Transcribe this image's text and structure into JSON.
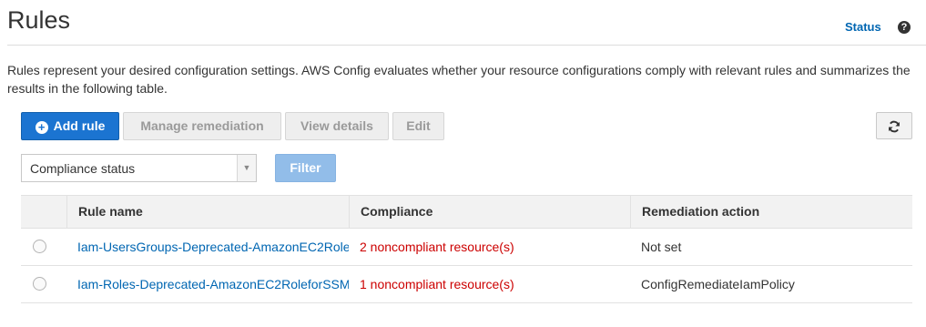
{
  "header": {
    "title": "Rules",
    "status_link": "Status",
    "help_symbol": "?"
  },
  "description": "Rules represent your desired configuration settings. AWS Config evaluates whether your resource configurations comply with relevant rules and summarizes the results in the following table.",
  "toolbar": {
    "add_rule": "Add rule",
    "add_rule_icon": "plus-circle-icon",
    "manage_remediation": "Manage remediation",
    "view_details": "View details",
    "edit": "Edit",
    "refresh_icon": "refresh-icon"
  },
  "filter": {
    "select_value": "Compliance status",
    "filter_button": "Filter"
  },
  "table": {
    "columns": [
      "Rule name",
      "Compliance",
      "Remediation action"
    ],
    "rows": [
      {
        "rule_name": "Iam-UsersGroups-Deprecated-AmazonEC2Role",
        "compliance": "2 noncompliant resource(s)",
        "remediation": "Not set"
      },
      {
        "rule_name": "Iam-Roles-Deprecated-AmazonEC2RoleforSSM",
        "compliance": "1 noncompliant resource(s)",
        "remediation": "ConfigRemediateIamPolicy"
      }
    ]
  },
  "colors": {
    "link": "#0066b2",
    "noncompliant": "#cc0000",
    "primary": "#1b74d1"
  }
}
